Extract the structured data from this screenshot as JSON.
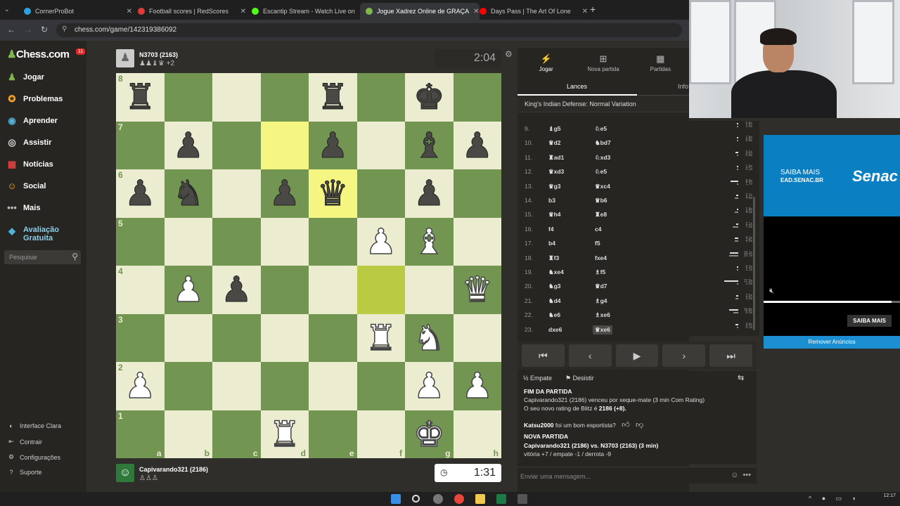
{
  "browser": {
    "tabs": [
      {
        "title": "CornerProBot",
        "color": "#2aa3e0"
      },
      {
        "title": "Football scores | RedScores",
        "color": "#e23a3a"
      },
      {
        "title": "Escantip Stream - Watch Live on",
        "color": "#53fc18"
      },
      {
        "title": "Jogue Xadrez Online de GRAÇA",
        "color": "#81b64c"
      },
      {
        "title": "Days Pass | The Art Of Lone",
        "color": "#ff0000"
      }
    ],
    "active_tab": 3,
    "url": "chess.com/game/142319386092"
  },
  "sidebar": {
    "logo_text": "Chess.com",
    "notification_count": "11",
    "items": [
      {
        "label": "Jogar",
        "icon": "♟"
      },
      {
        "label": "Problemas",
        "icon": "✪"
      },
      {
        "label": "Aprender",
        "icon": "◉"
      },
      {
        "label": "Assistir",
        "icon": "◎"
      },
      {
        "label": "Notícias",
        "icon": "▦"
      },
      {
        "label": "Social",
        "icon": "☺"
      },
      {
        "label": "Mais",
        "icon": "•••"
      }
    ],
    "premium": {
      "label": "Avaliação Gratuita",
      "icon": "◆"
    },
    "search_placeholder": "Pesquisar",
    "footer": [
      {
        "label": "Interface Clara",
        "icon": "◐"
      },
      {
        "label": "Contrair",
        "icon": "⇤"
      },
      {
        "label": "Configurações",
        "icon": "⚙"
      },
      {
        "label": "Suporte",
        "icon": "?"
      }
    ]
  },
  "game": {
    "top_player": {
      "name": "N3703 (2163)",
      "captured": "♟♟♝♛ +2",
      "clock": "2:04"
    },
    "bottom_player": {
      "name": "Capivarando321 (2186)",
      "captured": "♙♙♙",
      "clock": "1:31"
    },
    "board": [
      [
        "r",
        "",
        "",
        "",
        "r",
        "",
        "k",
        ""
      ],
      [
        "",
        "p",
        "",
        "",
        "p",
        "",
        "b",
        "p"
      ],
      [
        "p",
        "n",
        "",
        "p",
        "q",
        "",
        "p",
        ""
      ],
      [
        "",
        "",
        "",
        "",
        "",
        "P",
        "B",
        ""
      ],
      [
        "",
        "P",
        "p",
        "",
        "",
        "",
        "",
        "Q"
      ],
      [
        "",
        "",
        "",
        "",
        "",
        "R",
        "N",
        ""
      ],
      [
        "P",
        "",
        "",
        "",
        "",
        "",
        "P",
        "P"
      ],
      [
        "",
        "",
        "",
        "R",
        "",
        "",
        "K",
        ""
      ]
    ],
    "highlights": [
      "d7",
      "e6",
      "f4"
    ],
    "ranks": [
      "8",
      "7",
      "6",
      "5",
      "4",
      "3",
      "2",
      "1"
    ],
    "files": [
      "a",
      "b",
      "c",
      "d",
      "e",
      "f",
      "g",
      "h"
    ]
  },
  "panel": {
    "tabs": [
      {
        "label": "Jogar",
        "icon": "⚡"
      },
      {
        "label": "Nova partida",
        "icon": "⊞"
      },
      {
        "label": "Partidas",
        "icon": "▦"
      }
    ],
    "subtabs": [
      "Lances",
      "Info"
    ],
    "opening": "King's Indian Defense: Normal Variation",
    "moves": [
      {
        "n": "9.",
        "w": "♝g5",
        "b": "♘e5",
        "tw": "0.8s",
        "tb": "1.6s"
      },
      {
        "n": "10.",
        "w": "♛d2",
        "b": "♞bd7",
        "tw": "1.8s",
        "tb": "0.8s"
      },
      {
        "n": "11.",
        "w": "♜ad1",
        "b": "♘xd3",
        "tw": "3.2s",
        "tb": "0.9s"
      },
      {
        "n": "12.",
        "w": "♛xd3",
        "b": "♘e5",
        "tw": "1.0s",
        "tb": "0.1s"
      },
      {
        "n": "13.",
        "w": "♛g3",
        "b": "♛xc4",
        "tw": "8.9s",
        "tb": "1.7s"
      },
      {
        "n": "14.",
        "w": "b3",
        "b": "♛b6",
        "tw": "2.7s",
        "tb": "4.4s"
      },
      {
        "n": "15.",
        "w": "♛h4",
        "b": "♜e8",
        "tw": "1.8s",
        "tb": "4.3s"
      },
      {
        "n": "16.",
        "w": "f4",
        "b": "c4",
        "tw": "2.1s",
        "tb": "7.0s"
      },
      {
        "n": "17.",
        "w": "b4",
        "b": "f5",
        "tw": "4.1s",
        "tb": "4.5s"
      },
      {
        "n": "18.",
        "w": "♜f3",
        "b": "fxe4",
        "tw": "10.1s",
        "tb": "10.7s"
      },
      {
        "n": "19.",
        "w": "♞xe4",
        "b": "♗f5",
        "tw": "0.1s",
        "tb": "1.1s"
      },
      {
        "n": "20.",
        "w": "♞g3",
        "b": "♛d7",
        "tw": "17.3s",
        "tb": "1.0s"
      },
      {
        "n": "21.",
        "w": "♞d4",
        "b": "♗g4",
        "tw": "2.5s",
        "tb": "3.5s"
      },
      {
        "n": "22.",
        "w": "♞e6",
        "b": "♗xe6",
        "tw": "10.8s",
        "tb": "6.0s"
      },
      {
        "n": "23.",
        "w": "dxe6",
        "b": "♛xe6",
        "tw": "3.0s",
        "tb": "0.1s"
      }
    ],
    "controls": [
      "⏮",
      "‹",
      "▶",
      "›",
      "⏭"
    ],
    "draw_label": "Empate",
    "resign_label": "Desistir",
    "chat": {
      "end_title": "FIM DA PARTIDA",
      "result": "Capivarando321 (2186) venceu por xeque-mate (3 min Com Rating)",
      "rating_prefix": "O seu novo rating de Blitz é",
      "rating_value": "2186 (+8).",
      "sportsman_user": "Katsu2000",
      "sportsman_text": "foi um bom esportista?",
      "new_game_title": "NOVA PARTIDA",
      "new_game_players": "Capivarando321 (2186) vs. N3703 (2163) (3 min)",
      "new_game_stats": "vitória +7 / empate -1 / derrota -9",
      "input_placeholder": "Enviar uma mensagem..."
    }
  },
  "ad": {
    "line1": "SAIBA MAIS",
    "line2": "EAD.SENAC.BR",
    "brand": "Senac",
    "cta": "SAIBA MAIS",
    "remove": "Remover Anúncios",
    "progress": 0.94
  },
  "taskbar": {
    "time": "12:17"
  }
}
